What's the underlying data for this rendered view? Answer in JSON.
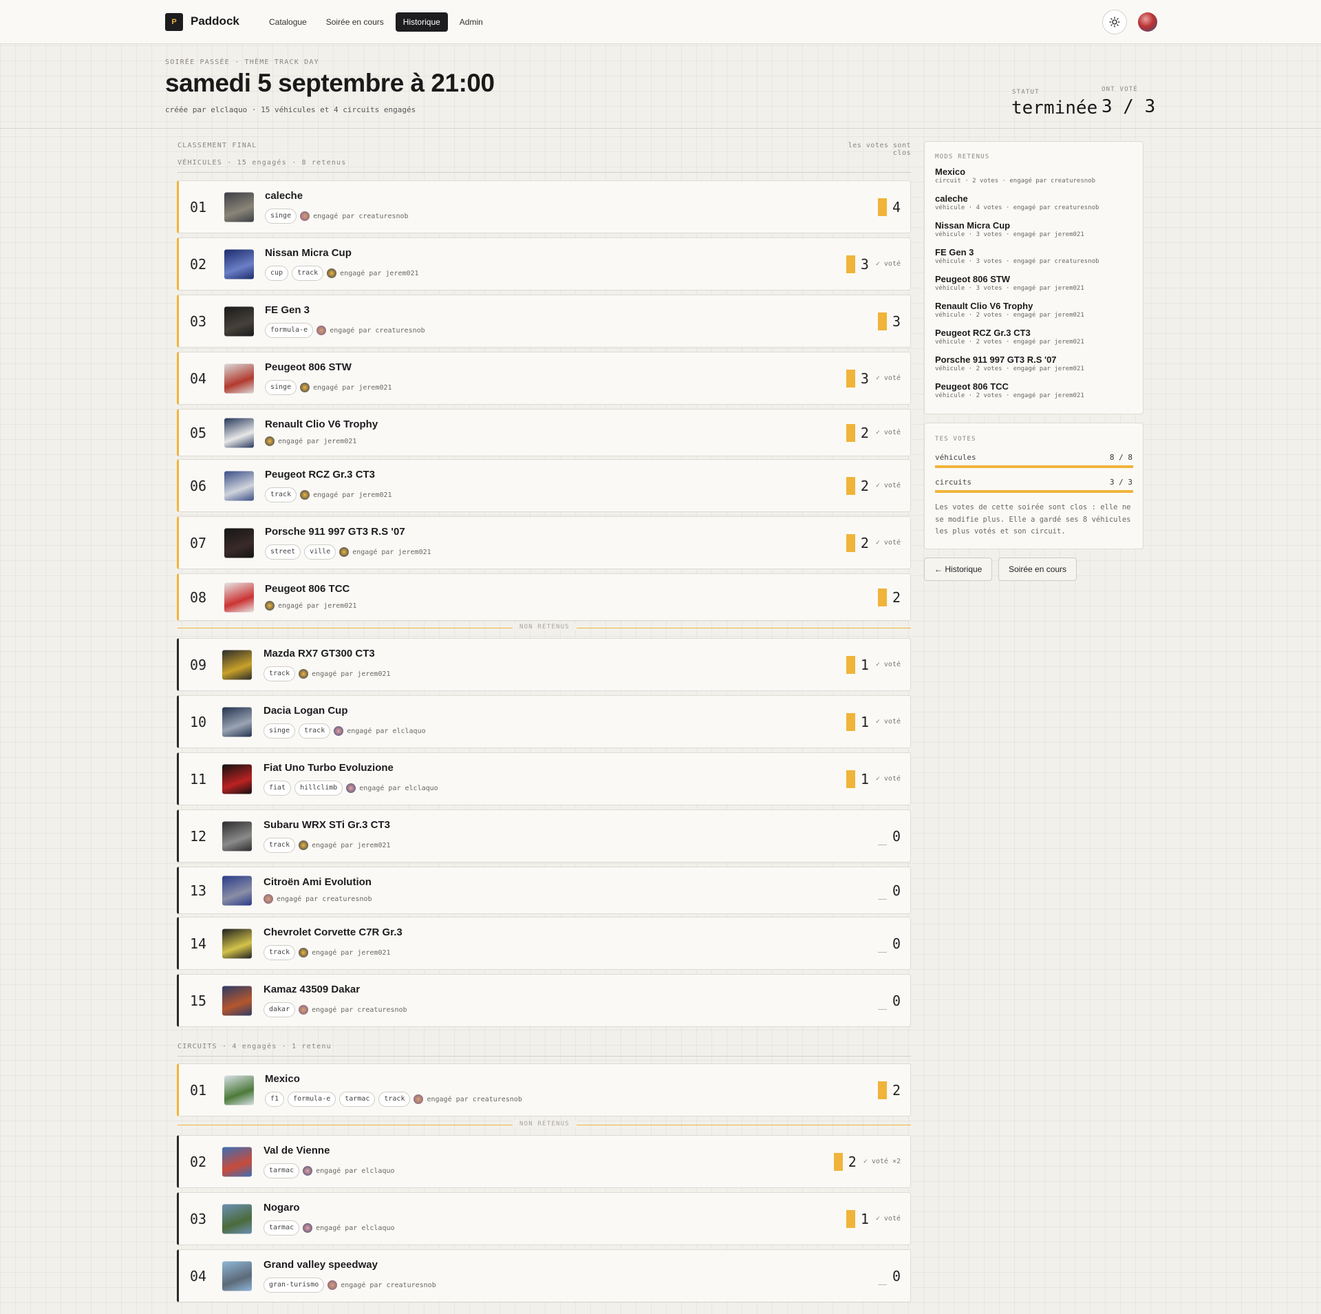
{
  "nav": {
    "logo_letter": "P",
    "brand": "Paddock",
    "items": [
      "Catalogue",
      "Soirée en cours",
      "Historique",
      "Admin"
    ],
    "active": "Historique"
  },
  "header": {
    "eyebrow": "SOIRÉE PASSÉE · THÈME TRACK DAY",
    "title": "samedi 5 septembre à 21:00",
    "subtitle": "créée par elclaquo · 15 véhicules et 4 circuits engagés",
    "status_label": "STATUT",
    "status_value": "terminée",
    "voted_label": "ONT VOTÉ",
    "voted_value": "3 / 3"
  },
  "ranking": {
    "label": "CLASSEMENT FINAL",
    "closed_note": "les votes sont clos",
    "not_kept_label": "NON RETENUS"
  },
  "vehicles": {
    "label": "VÉHICULES · 15 engagés · 8 retenus",
    "rows": [
      {
        "rank": "01",
        "name": "caleche",
        "tags": [
          "singe"
        ],
        "by": "engagé par creaturesnob",
        "score": "4",
        "voted": "",
        "kept": true
      },
      {
        "rank": "02",
        "name": "Nissan Micra Cup",
        "tags": [
          "cup",
          "track"
        ],
        "by": "engagé par jerem021",
        "score": "3",
        "voted": "✓ voté",
        "kept": true
      },
      {
        "rank": "03",
        "name": "FE Gen 3",
        "tags": [
          "formula-e"
        ],
        "by": "engagé par creaturesnob",
        "score": "3",
        "voted": "",
        "kept": true
      },
      {
        "rank": "04",
        "name": "Peugeot 806 STW",
        "tags": [
          "singe"
        ],
        "by": "engagé par jerem021",
        "score": "3",
        "voted": "✓ voté",
        "kept": true
      },
      {
        "rank": "05",
        "name": "Renault Clio V6 Trophy",
        "tags": [],
        "by": "engagé par jerem021",
        "score": "2",
        "voted": "✓ voté",
        "kept": true
      },
      {
        "rank": "06",
        "name": "Peugeot RCZ Gr.3 CT3",
        "tags": [
          "track"
        ],
        "by": "engagé par jerem021",
        "score": "2",
        "voted": "✓ voté",
        "kept": true
      },
      {
        "rank": "07",
        "name": "Porsche 911 997 GT3 R.S '07",
        "tags": [
          "street",
          "ville"
        ],
        "by": "engagé par jerem021",
        "score": "2",
        "voted": "✓ voté",
        "kept": true
      },
      {
        "rank": "08",
        "name": "Peugeot 806 TCC",
        "tags": [],
        "by": "engagé par jerem021",
        "score": "2",
        "voted": "",
        "kept": true
      },
      {
        "rank": "09",
        "name": "Mazda RX7 GT300 CT3",
        "tags": [
          "track"
        ],
        "by": "engagé par jerem021",
        "score": "1",
        "voted": "✓ voté",
        "kept": false
      },
      {
        "rank": "10",
        "name": "Dacia Logan Cup",
        "tags": [
          "singe",
          "track"
        ],
        "by": "engagé par elclaquo",
        "score": "1",
        "voted": "✓ voté",
        "kept": false
      },
      {
        "rank": "11",
        "name": "Fiat Uno Turbo Evoluzione",
        "tags": [
          "fiat",
          "hillclimb"
        ],
        "by": "engagé par elclaquo",
        "score": "1",
        "voted": "✓ voté",
        "kept": false
      },
      {
        "rank": "12",
        "name": "Subaru WRX STi Gr.3 CT3",
        "tags": [
          "track"
        ],
        "by": "engagé par jerem021",
        "score": "0",
        "voted": "",
        "kept": false
      },
      {
        "rank": "13",
        "name": "Citroën Ami Evolution",
        "tags": [],
        "by": "engagé par creaturesnob",
        "score": "0",
        "voted": "",
        "kept": false
      },
      {
        "rank": "14",
        "name": "Chevrolet Corvette C7R Gr.3",
        "tags": [
          "track"
        ],
        "by": "engagé par jerem021",
        "score": "0",
        "voted": "",
        "kept": false
      },
      {
        "rank": "15",
        "name": "Kamaz 43509 Dakar",
        "tags": [
          "dakar"
        ],
        "by": "engagé par creaturesnob",
        "score": "0",
        "voted": "",
        "kept": false
      }
    ]
  },
  "circuits": {
    "label": "CIRCUITS · 4 engagés · 1 retenu",
    "rows": [
      {
        "rank": "01",
        "name": "Mexico",
        "tags": [
          "f1",
          "formula-e",
          "tarmac",
          "track"
        ],
        "by": "engagé par creaturesnob",
        "score": "2",
        "voted": "",
        "kept": true
      },
      {
        "rank": "02",
        "name": "Val de Vienne",
        "tags": [
          "tarmac"
        ],
        "by": "engagé par elclaquo",
        "score": "2",
        "voted": "✓ voté ×2",
        "kept": false
      },
      {
        "rank": "03",
        "name": "Nogaro",
        "tags": [
          "tarmac"
        ],
        "by": "engagé par elclaquo",
        "score": "1",
        "voted": "✓ voté",
        "kept": false
      },
      {
        "rank": "04",
        "name": "Grand valley speedway",
        "tags": [
          "gran-turismo"
        ],
        "by": "engagé par creaturesnob",
        "score": "0",
        "voted": "",
        "kept": false
      }
    ]
  },
  "mods_panel": {
    "title": "MODS RETENUS",
    "items": [
      {
        "name": "Mexico",
        "meta": "circuit · 2 votes · engagé par creaturesnob"
      },
      {
        "name": "caleche",
        "meta": "véhicule · 4 votes · engagé par creaturesnob"
      },
      {
        "name": "Nissan Micra Cup",
        "meta": "véhicule · 3 votes · engagé par jerem021"
      },
      {
        "name": "FE Gen 3",
        "meta": "véhicule · 3 votes · engagé par creaturesnob"
      },
      {
        "name": "Peugeot 806 STW",
        "meta": "véhicule · 3 votes · engagé par jerem021"
      },
      {
        "name": "Renault Clio V6 Trophy",
        "meta": "véhicule · 2 votes · engagé par jerem021"
      },
      {
        "name": "Peugeot RCZ Gr.3 CT3",
        "meta": "véhicule · 2 votes · engagé par jerem021"
      },
      {
        "name": "Porsche 911 997 GT3 R.S '07",
        "meta": "véhicule · 2 votes · engagé par jerem021"
      },
      {
        "name": "Peugeot 806 TCC",
        "meta": "véhicule · 2 votes · engagé par jerem021"
      }
    ]
  },
  "votes_panel": {
    "title": "TES VOTES",
    "vehicles_label": "véhicules",
    "vehicles_count": "8 / 8",
    "vehicles_fill": 1.0,
    "circuits_label": "circuits",
    "circuits_count": "3 / 3",
    "circuits_fill": 1.0,
    "note": "Les votes de cette soirée sont clos : elle ne se modifie plus. Elle a gardé ses 8 véhicules les plus votés et son circuit."
  },
  "actions": {
    "history": "← Historique",
    "current": "Soirée en cours"
  },
  "colors": {
    "accent": "#f0b43a",
    "dark": "#1d1d1f",
    "background": "#f2f0eb"
  },
  "icons": {
    "theme_toggle": "sun-icon",
    "avatar": "user-avatar"
  }
}
